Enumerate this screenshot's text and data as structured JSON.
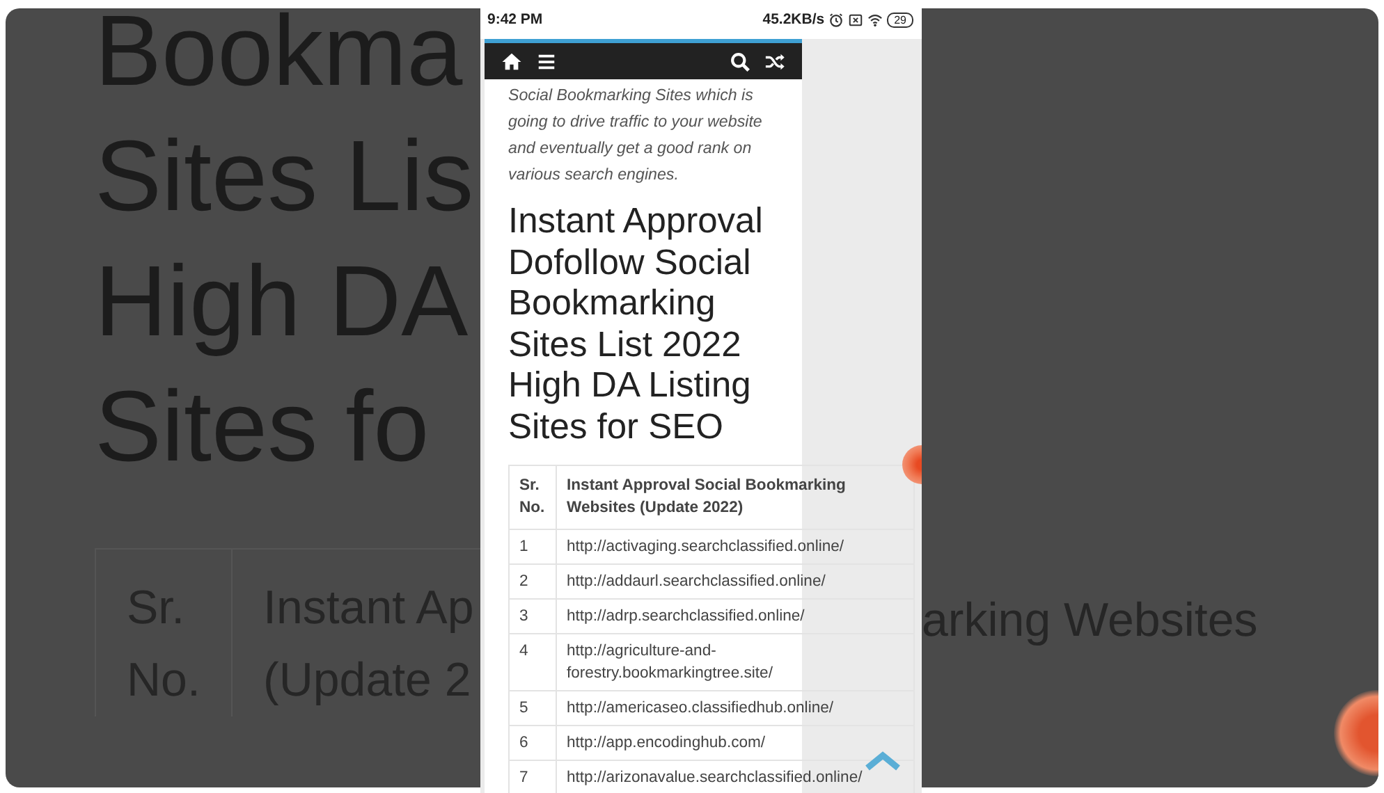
{
  "background": {
    "heading_lines": [
      "Bookma",
      "Sites Lis",
      "High DA",
      "Sites fo"
    ],
    "header_col1": [
      "Sr.",
      "No."
    ],
    "header_col2": [
      "Instant Ap",
      "(Update 2"
    ],
    "header_col2_right": "arking Websites"
  },
  "status_bar": {
    "time": "9:42 PM",
    "net_speed": "45.2KB/s",
    "battery": "29"
  },
  "article": {
    "intro": "Social Bookmarking Sites which is going to drive traffic to your website and eventually get a good rank on various search engines.",
    "heading": "Instant Approval Dofollow Social Bookmarking Sites List 2022 High DA Listing Sites for SEO",
    "table": {
      "columns": [
        "Sr. No.",
        "Instant Approval Social Bookmarking Websites (Update 2022)"
      ],
      "rows": [
        [
          "1",
          "http://activaging.searchclassified.online/"
        ],
        [
          "2",
          "http://addaurl.searchclassified.online/"
        ],
        [
          "3",
          "http://adrp.searchclassified.online/"
        ],
        [
          "4",
          "http://agriculture-and-forestry.bookmarkingtree.site/"
        ],
        [
          "5",
          "http://americaseo.classifiedhub.online/"
        ],
        [
          "6",
          "http://app.encodinghub.com/"
        ],
        [
          "7",
          "http://arizonavalue.searchclassified.online/"
        ]
      ]
    }
  }
}
